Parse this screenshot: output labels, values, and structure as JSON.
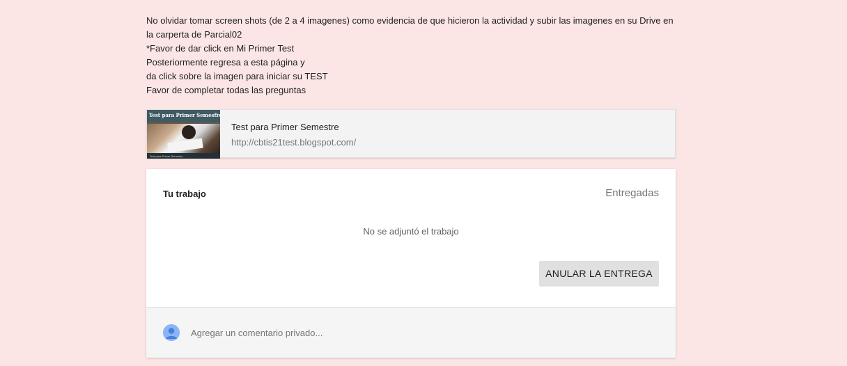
{
  "instructions": {
    "line1": "No olvidar tomar screen shots (de 2 a 4 imagenes) como evidencia de que hicieron la actividad y subir las imagenes en su Drive en",
    "line2": "la carperta de Parcial02",
    "line3": "*Favor de dar click en Mi Primer Test",
    "line4": "Posteriormente regresa a esta página y",
    "line5": "da click sobre la imagen para iniciar su TEST",
    "line6": "Favor de completar todas las preguntas"
  },
  "attachment": {
    "thumbnail_title": "Test para Primer Semestre",
    "thumbnail_footer": "Test para Primer Semestre",
    "title": "Test para Primer Semestre",
    "url": "http://cbtis21test.blogspot.com/"
  },
  "work": {
    "title": "Tu trabajo",
    "status": "Entregadas",
    "empty_message": "No se adjuntó el trabajo",
    "unsubmit_label": "ANULAR LA ENTREGA"
  },
  "comment": {
    "placeholder": "Agregar un comentario privado..."
  },
  "colors": {
    "page_background": "#fbe6e5",
    "card_background": "#ffffff",
    "button_background": "#e0e0e0",
    "avatar": "#8ab4f8"
  },
  "icons": {
    "avatar": "person-avatar-icon"
  }
}
